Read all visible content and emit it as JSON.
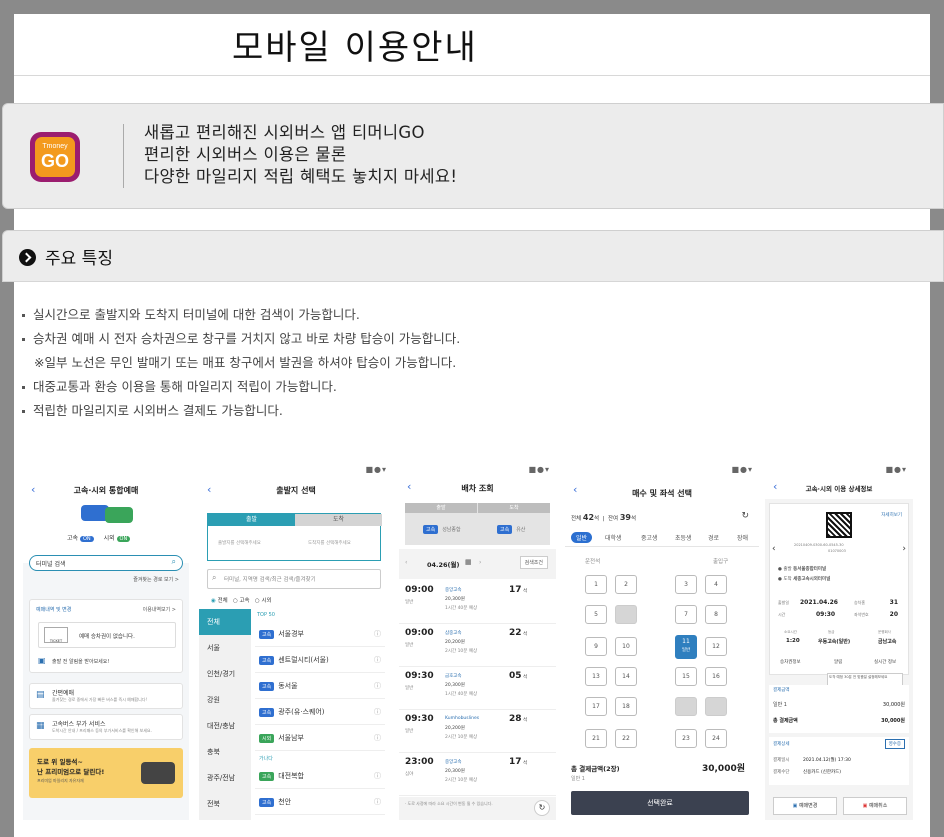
{
  "page": {
    "title": "모바일 이용안내"
  },
  "intro": {
    "icon": "tmoney-go-app-icon",
    "icon_brand": "Tmoney",
    "icon_text": "GO",
    "lines": [
      "새롭고 편리해진 시외버스 앱 티머니GO",
      "편리한 시외버스 이용은 물론",
      "다양한 마일리지 적립 혜택도 놓치지 마세요!"
    ]
  },
  "features": {
    "title": "주요 특징",
    "items": [
      "실시간으로 출발지와 도착지 터미널에 대한 검색이 가능합니다.",
      "승차권 예매 시 전자 승차권으로 창구를 거치지 않고 바로 차량 탑승이 가능합니다."
    ],
    "note": "※일부 노선은 무인 발매기 또는 매표 창구에서 발권을 하셔야 탑승이 가능합니다.",
    "items2": [
      "대중교통과 환승 이용을 통해 마일리지 적립이 가능합니다.",
      "적립한 마일리지로 시외버스 결제도 가능합니다."
    ]
  },
  "screens": {
    "s1": {
      "title": "고속·시외 통합예매",
      "toggle_express": "고속",
      "toggle_intercity": "시외",
      "toggle_on": "ON",
      "search_placeholder": "터미널 검색",
      "favorites": "즐겨찾는 경로 보기 >",
      "reserve_title": "예매내역 및 변경",
      "reserve_link": "이용내역보기 >",
      "no_ticket": "예매 승차권이 없습니다.",
      "ticket_label": "TICKET",
      "notice": "출발 전 알림을 받아보세요!",
      "menu1": "간편예매",
      "menu1_sub": "즐겨찾는 경로 중에서 가장 빠른 버스를 즉시 예매합니다!",
      "menu2": "고속버스 부가 서비스",
      "menu2_sub": "도착시간 안내 / 프리패스 등의 부가서비스를 확인해 보세요.",
      "banner1": "도로 위 일등석~",
      "banner2": "난 프리미엄으로 달린다!",
      "banner3": "프리미엄 마일리지 자유자재"
    },
    "s2": {
      "title": "출발지 선택",
      "tab_depart": "출발",
      "tab_arrive": "도착",
      "depart_hint": "출발지를 선택해주세요",
      "arrive_hint": "도착지를 선택해주세요",
      "search_placeholder": "터미널, 지역명 검색/최근 검색/즐겨찾기",
      "radio_all": "전체",
      "radio_express": "고속",
      "radio_intercity": "시외",
      "regions": [
        "전체",
        "서울",
        "인천/경기",
        "강원",
        "대전/충남",
        "충북",
        "광주/전남",
        "전북"
      ],
      "top_label": "TOP 50",
      "routes": [
        {
          "tag": "고속",
          "name": "서울경부"
        },
        {
          "tag": "고속",
          "name": "센트럴시티(서울)"
        },
        {
          "tag": "고속",
          "name": "동서울"
        },
        {
          "tag": "고속",
          "name": "광주(유·스퀘어)"
        },
        {
          "tag": "시외",
          "name": "서울남부"
        }
      ],
      "section_label": "가나다",
      "routes2": [
        {
          "tag": "고속",
          "name": "대전복합"
        },
        {
          "tag": "고속",
          "name": "천안"
        }
      ]
    },
    "s3": {
      "title": "배차 조회",
      "depart_label": "출발",
      "arrive_label": "도착",
      "depart_name": "성남종합",
      "arrive_name": "유산",
      "date": "04.26(월)",
      "filter": "검색조건",
      "schedules": [
        {
          "time": "09:00",
          "type": "일반",
          "company": "중앙고속",
          "price": "20,300원",
          "seats": "17",
          "unit": "석",
          "dur": "1시간 40분 예상"
        },
        {
          "time": "09:00",
          "type": "일반",
          "company": "삼중고속",
          "price": "20,200원",
          "seats": "22",
          "unit": "석",
          "dur": "2시간 10분 예상"
        },
        {
          "time": "09:30",
          "type": "일반",
          "company": "금호고속",
          "price": "20,300원",
          "seats": "05",
          "unit": "석",
          "dur": "1시간 40분 예상"
        },
        {
          "time": "09:30",
          "type": "일반",
          "company": "Kumhobuslines",
          "price": "20,200원",
          "seats": "28",
          "unit": "석",
          "dur": "2시간 10분 예상"
        },
        {
          "time": "23:00",
          "type": "심야",
          "company": "중앙고속",
          "price": "20,300원",
          "seats": "17",
          "unit": "석",
          "dur": "2시간 10분 예상"
        }
      ],
      "footnote": "· 도로 사정에 따라 소요 시간이 변동 될 수 있습니다."
    },
    "s4": {
      "title": "매수 및 좌석 선택",
      "total_label": "전체",
      "total": "42",
      "remain_label": "잔여",
      "remain": "39",
      "seat_unit": "석",
      "cats": [
        "일반",
        "대학생",
        "중고생",
        "초등생",
        "경로",
        "장애"
      ],
      "driver": "운전석",
      "door": "출입구",
      "total_price_label": "총 결제금액(2장)",
      "total_price": "30,000원",
      "price_sub": "일반 1",
      "confirm": "선택완료",
      "selected_seat": "11",
      "selected_label": "일반"
    },
    "s5": {
      "title": "고속·시외 이용 상세정보",
      "link": "자세히보기",
      "code": "20210409-0300-60-0545-30",
      "code2": "01070003",
      "depart_label": "출발",
      "depart": "동서울종합터미널",
      "arrive_label": "도착",
      "arrive": "세종고속시외터미널",
      "date_label": "출발일",
      "date": "2021.04.26",
      "seat_label": "승차홈",
      "seat": "31",
      "time_label": "시간",
      "time": "09:30",
      "seatno_label": "좌석번호",
      "seatno": "20",
      "dur_label": "소요시간",
      "dur": "1:20",
      "grade_label": "등급",
      "grade": "우등고속(일반)",
      "company_label": "운행회사",
      "company": "금남고속",
      "btn1": "승차권정보",
      "btn2": "알림",
      "btn3": "실시간 정보",
      "pay_title": "결제금액",
      "pay_row": "일반 1",
      "pay_value": "30,000원",
      "total_label": "총 결제금액",
      "total_value": "30,000원",
      "detail_title": "결제상세",
      "receipt": "영수증",
      "pay_date_label": "결제일시",
      "pay_date": "2021.04.12(월) 17:30",
      "pay_method_label": "결제수단",
      "pay_method": "신용카드 (신한카드)",
      "cancel_change": "예매변경",
      "cancel": "예매취소",
      "note": "도착 예정 30분 전 맞춤일 설정해보세요"
    }
  }
}
